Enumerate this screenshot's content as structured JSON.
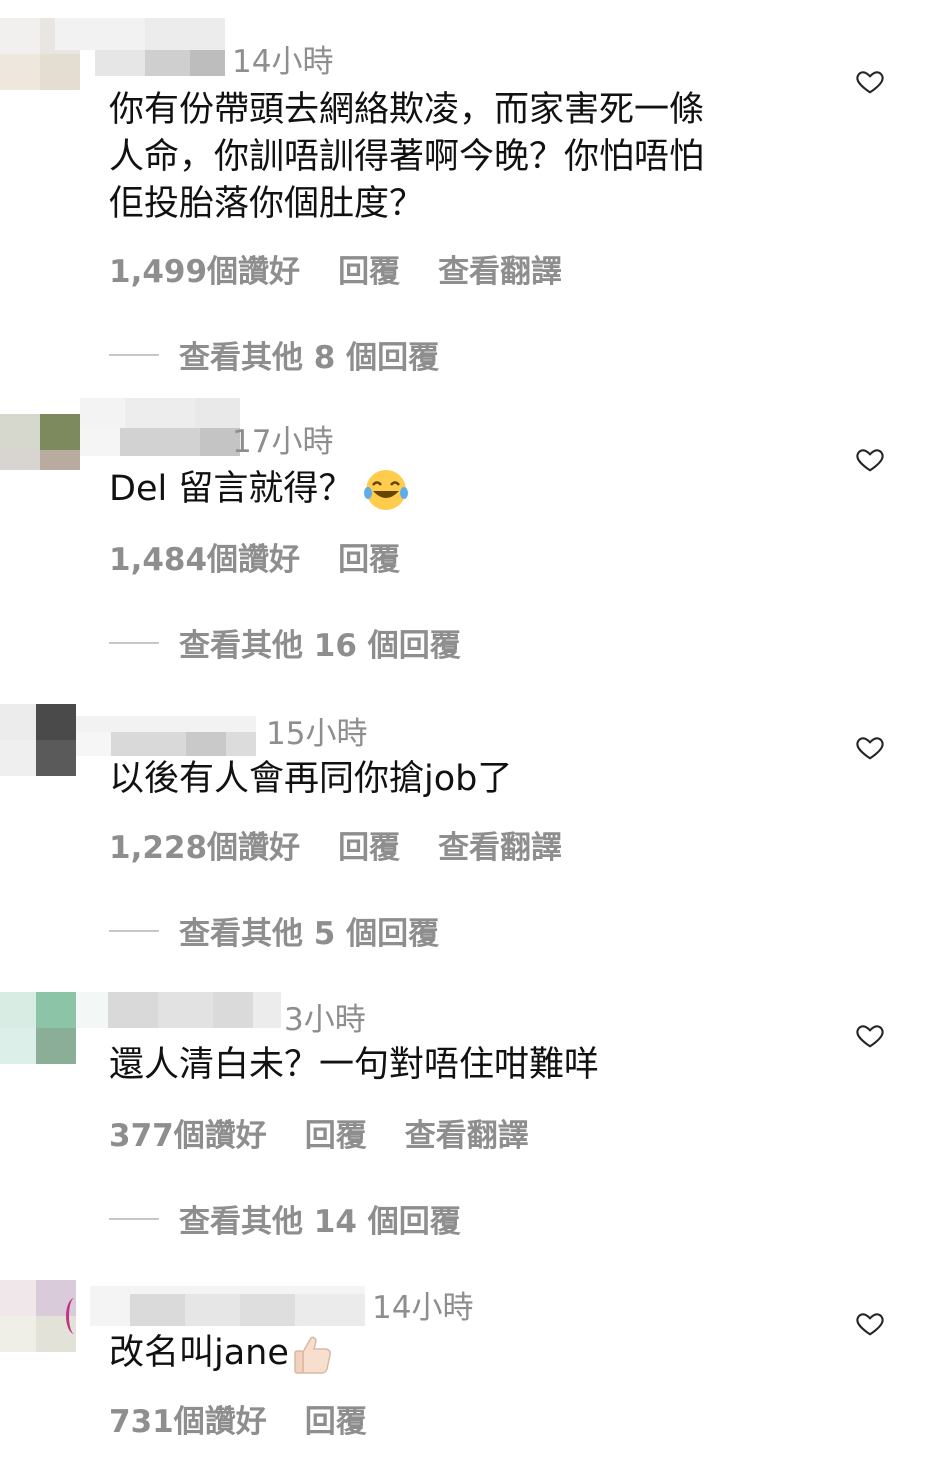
{
  "comments": [
    {
      "time": "14小時",
      "text": "你有份帶頭去網絡欺凌，而家害死一條\n人命，你訓唔訓得著啊今晚？你怕唔怕\n佢投胎落你個肚度？",
      "likes": "1,499個讚好",
      "reply": "回覆",
      "translate": "查看翻譯",
      "view_replies": "查看其他 8 個回覆"
    },
    {
      "time": "17小時",
      "text": "Del 留言就得？",
      "emoji": "laughing-tears",
      "likes": "1,484個讚好",
      "reply": "回覆",
      "view_replies": "查看其他 16 個回覆"
    },
    {
      "time": "15小時",
      "text": "以後有人會再同你搶job了",
      "likes": "1,228個讚好",
      "reply": "回覆",
      "translate": "查看翻譯",
      "view_replies": "查看其他 5 個回覆"
    },
    {
      "time": "3小時",
      "text": "還人清白未？一句對唔住咁難咩",
      "likes": "377個讚好",
      "reply": "回覆",
      "translate": "查看翻譯",
      "view_replies": "查看其他 14 個回覆"
    },
    {
      "time": "14小時",
      "text": "改名叫jane",
      "emoji": "thumbs-up",
      "likes": "731個讚好",
      "reply": "回覆"
    }
  ],
  "colors": {
    "meta": "#8e8e8e",
    "text": "#111111",
    "divider": "#c7c7c7"
  },
  "icons": {
    "like": "heart-outline-icon"
  }
}
